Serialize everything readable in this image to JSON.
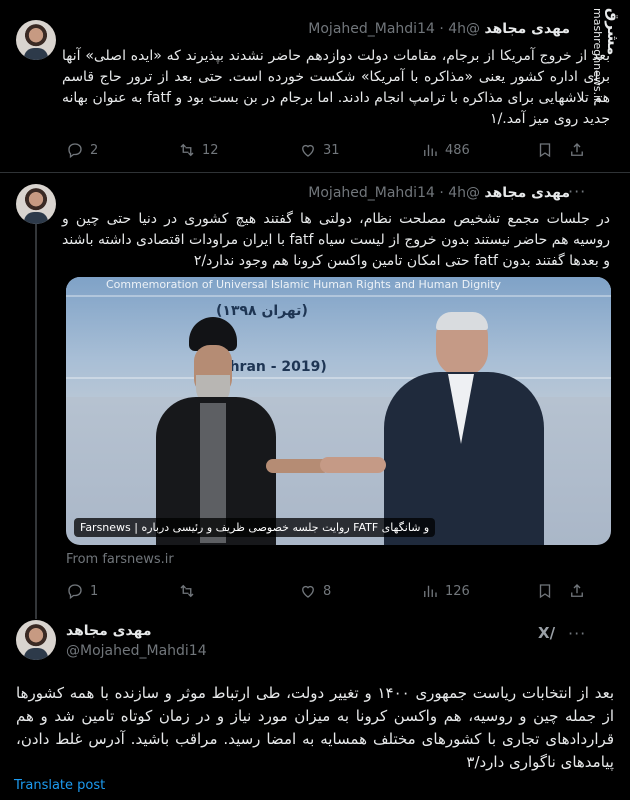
{
  "watermark": {
    "logo": "مشرق",
    "url": "mashreghnews.ir"
  },
  "tweets": [
    {
      "name": "مهدی مجاهد",
      "handle": "@Mojahed_Mahdi14",
      "dot": "·",
      "time": "4h",
      "more": "···",
      "text": "بعد از خروج آمریکا از برجام، مقامات دولت دوازدهم حاضر نشدند بپذیرند که «ایده اصلی» آنها برای اداره کشور یعنی «مذاکره با آمریکا» شکست خورده است. حتی بعد از ترور حاج قاسم هم تلاشهایی برای مذاکره با ترامپ انجام دادند. اما برجام در بن بست بود و fatf به عنوان بهانه جدید روی میز آمد./۱",
      "replies": "2",
      "retweets": "12",
      "likes": "31",
      "views": "486"
    },
    {
      "name": "مهدی مجاهد",
      "handle": "@Mojahed_Mahdi14",
      "dot": "·",
      "time": "4h",
      "more": "···",
      "text": "در جلسات مجمع تشخیص مصلحت نظام، دولتی ها گفتند هیچ کشوری در دنیا حتی چین و روسیه هم حاضر نیستند بدون خروج از لیست سیاه fatf با ایران مراودات اقتصادی داشته باشند و بعدها گفتند بدون fatf حتی امکان تامین واکسن کرونا هم وجود ندارد/۲",
      "media": {
        "caption": "و شانگهای FATF روایت جلسه خصوصی ظریف و رئیسی درباره | Farsnews",
        "banner_en": "Commemoration of Universal Islamic Human Rights and Human Dignity",
        "banner_fa": "(تهران ۱۳۹۸)",
        "banner_year": "(Tehran - 2019)",
        "source": "From farsnews.ir"
      },
      "replies": "1",
      "retweets": "",
      "likes": "8",
      "views": "126"
    },
    {
      "name": "مهدی مجاهد",
      "handle": "@Mojahed_Mahdi14",
      "more": "···",
      "grok": "X/",
      "text": "بعد از انتخابات ریاست جمهوری ۱۴۰۰ و تغییر دولت، طی ارتباط موثر و سازنده با همه کشورها از جمله چین و روسیه، هم واکسن کرونا به میزان مورد نیاز و در زمان کوتاه تامین شد و هم قراردادهای تجاری با کشورهای مختلف همسایه به امضا رسید. مراقب باشید. آدرس غلط دادن، پیامدهای ناگواری دارد/۳",
      "translate": "Translate post"
    }
  ]
}
